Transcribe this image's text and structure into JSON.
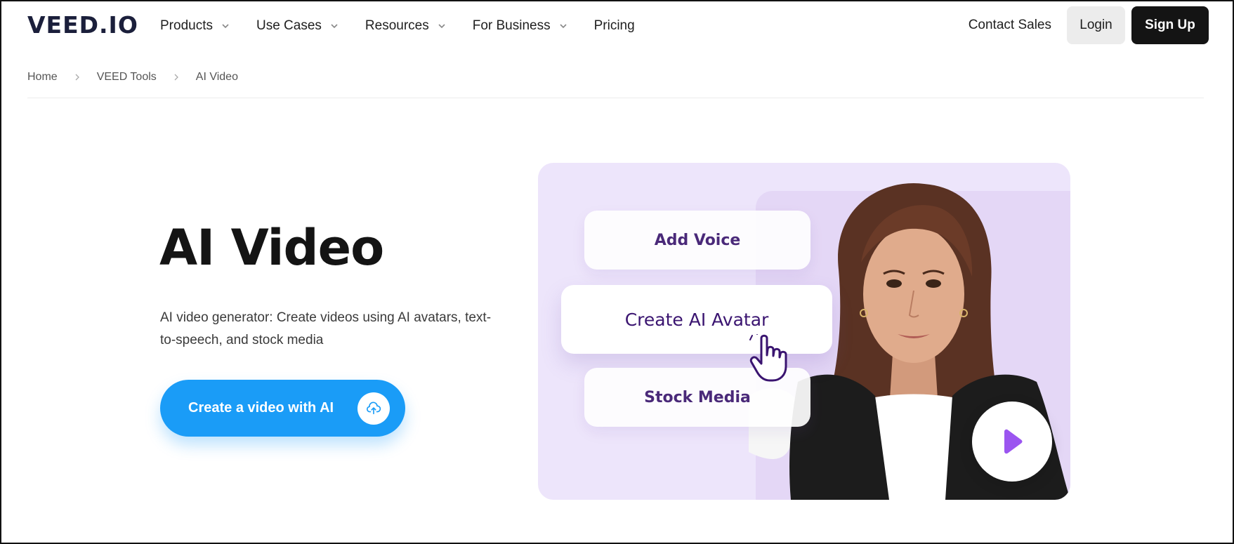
{
  "header": {
    "logo": "VEED.IO",
    "nav": [
      {
        "label": "Products",
        "has_dropdown": true
      },
      {
        "label": "Use Cases",
        "has_dropdown": true
      },
      {
        "label": "Resources",
        "has_dropdown": true
      },
      {
        "label": "For Business",
        "has_dropdown": true
      },
      {
        "label": "Pricing",
        "has_dropdown": false
      }
    ],
    "contact_label": "Contact Sales",
    "login_label": "Login",
    "signup_label": "Sign Up"
  },
  "breadcrumb": [
    "Home",
    "VEED Tools",
    "AI Video"
  ],
  "hero": {
    "title": "AI Video",
    "subtitle": "AI video generator: Create videos using AI avatars, text-to-speech, and stock media",
    "cta_label": "Create a video with AI",
    "cta_icon": "upload-cloud-icon"
  },
  "media": {
    "pills": [
      "Add Voice",
      "Create AI Avatar",
      "Stock Media"
    ],
    "play_icon": "play-icon",
    "cursor_icon": "hand-pointer-icon"
  },
  "colors": {
    "accent": "#1a9cf7",
    "card_bg": "#ede5fb",
    "pill_text": "#3d1a6e",
    "play": "#9b55f0",
    "signup_bg": "#141414"
  }
}
